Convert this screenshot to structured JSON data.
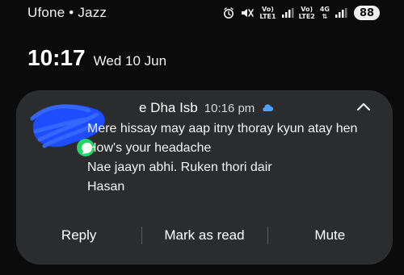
{
  "status_bar": {
    "carrier": "Ufone • Jazz",
    "lte1": "LTE1",
    "lte2": "LTE2",
    "net_4g": "4G",
    "battery": "88"
  },
  "lockscreen": {
    "time": "10:17",
    "date": "Wed 10 Jun"
  },
  "notification": {
    "sender": "e Dha Isb",
    "time": "10:16 pm",
    "messages": [
      "Mere hissay may aap itny thoray kyun atay hen",
      "How's your headache",
      "Nae jaayn abhi. Ruken thori dair",
      "Hasan"
    ],
    "actions": [
      "Reply",
      "Mark as read",
      "Mute"
    ]
  },
  "colors": {
    "background": "#0b0b0c",
    "card": "#2b2c2e",
    "text": "#ffffff",
    "scribble": "#1d4dff",
    "whatsapp": "#25d366",
    "cloud_blue": "#4aa3ff"
  },
  "icons": {
    "alarm": "alarm-icon",
    "mute": "mute-icon",
    "signal": "signal-icon",
    "cloud": "cloud-icon",
    "chevron": "chevron-up-icon",
    "whatsapp": "whatsapp-icon"
  }
}
